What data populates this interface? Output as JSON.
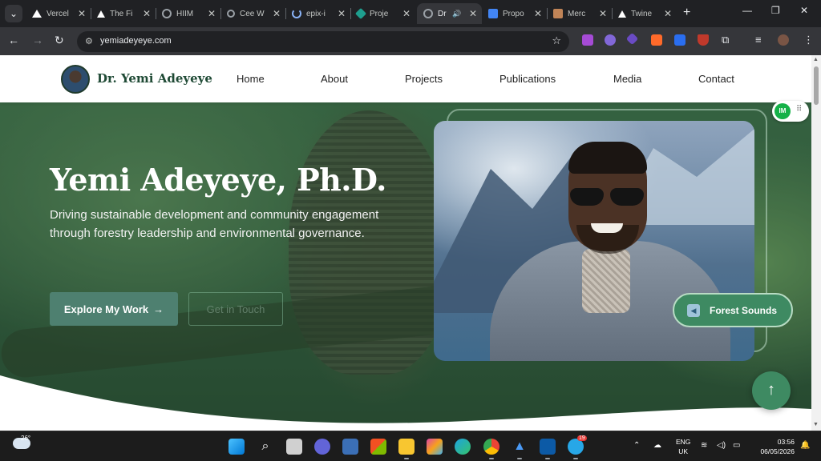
{
  "browser": {
    "tabs": [
      {
        "title": "Vercel",
        "favicon_color": "#ffffff"
      },
      {
        "title": "The Fi",
        "favicon_color": "#ffffff"
      },
      {
        "title": "HIIM",
        "favicon_color": "#9aa0a6"
      },
      {
        "title": "Cee W",
        "favicon_color": "#9aa0a6"
      },
      {
        "title": "epix-i",
        "favicon_color": "#8ab4f8"
      },
      {
        "title": "Proje",
        "favicon_color": "#1e9e8e"
      },
      {
        "title": "Dr",
        "favicon_color": "#9aa0a6",
        "active": true
      },
      {
        "title": "Propo",
        "favicon_color": "#4285f4"
      },
      {
        "title": "Merc",
        "favicon_color": "#c08457"
      },
      {
        "title": "Twine",
        "favicon_color": "#ffffff"
      }
    ],
    "url": "yemiadeyeye.com"
  },
  "site": {
    "logo_text": "Dr. Yemi Adeyeye",
    "nav": [
      "Home",
      "About",
      "Projects",
      "Publications",
      "Media",
      "Contact"
    ],
    "hero": {
      "title": "Yemi Adeyeye, Ph.D.",
      "subtitle": "Driving sustainable development and community engagement through forestry leadership and environmental governance.",
      "primary_button": "Explore My Work",
      "secondary_button": "Get in Touch"
    },
    "badge_label": "IM",
    "sound_button": "Forest Sounds",
    "colors": {
      "brand_green": "#1f4a35",
      "button_green": "#4e8070",
      "accent_green": "#3e8a62"
    }
  },
  "taskbar": {
    "temperature": "26°",
    "language": [
      "ENG",
      "UK"
    ],
    "time": "03:56",
    "date": "06/05/2026",
    "telegram_badge": "19"
  }
}
